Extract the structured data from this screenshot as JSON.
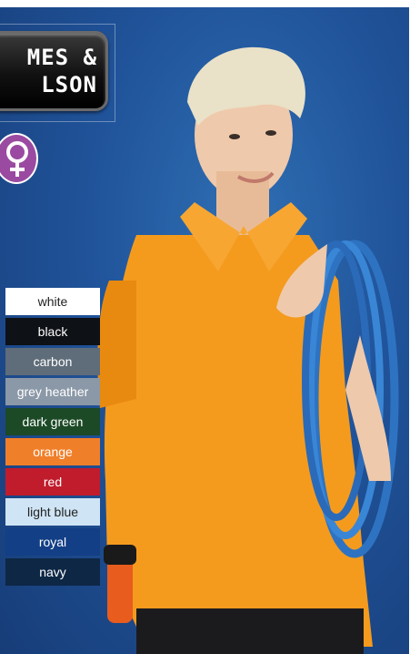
{
  "brand": {
    "logo_line1": "MES &",
    "logo_line2": "LSON"
  },
  "badge": {
    "icon": "female-symbol-icon",
    "color": "#9a4aa0"
  },
  "colors": [
    {
      "label": "white",
      "bg": "#ffffff",
      "fg": "#222222"
    },
    {
      "label": "black",
      "bg": "#0e1116",
      "fg": "#ffffff"
    },
    {
      "label": "carbon",
      "bg": "#5f6c79",
      "fg": "#ffffff"
    },
    {
      "label": "grey heather",
      "bg": "#8b98a7",
      "fg": "#ffffff"
    },
    {
      "label": "dark green",
      "bg": "#1c4a26",
      "fg": "#ffffff"
    },
    {
      "label": "orange",
      "bg": "#f07f2a",
      "fg": "#ffffff"
    },
    {
      "label": "red",
      "bg": "#c01c2c",
      "fg": "#ffffff"
    },
    {
      "label": "light blue",
      "bg": "#cfe4f4",
      "fg": "#222222"
    },
    {
      "label": "royal",
      "bg": "#123f86",
      "fg": "#ffffff"
    },
    {
      "label": "navy",
      "bg": "#0e2745",
      "fg": "#ffffff"
    }
  ]
}
